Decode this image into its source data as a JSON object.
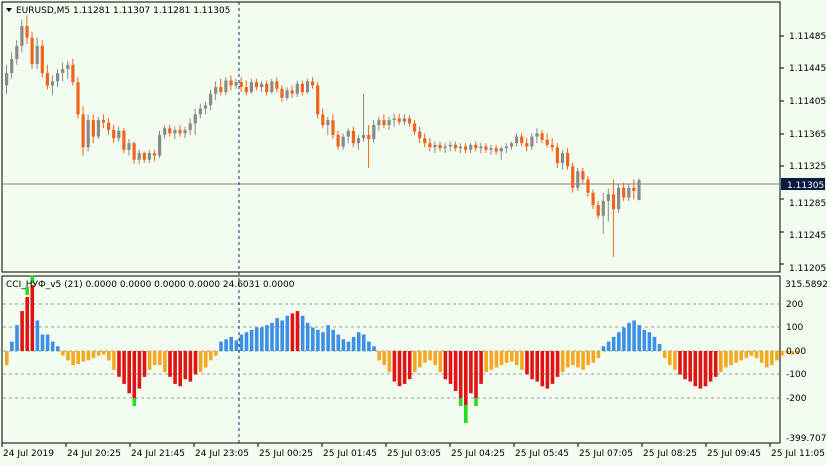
{
  "window": {
    "symbol_header": "EURUSD,M5  1.11281 1.11307 1.11281 1.11305",
    "indicator_header": "CCI_НУФ_v5 (21) 0.0000 0.0000 0.0000 0.0000 24.6031 0.0000",
    "current_price_label": "1.11305"
  },
  "colors": {
    "background": "#f2fdf0",
    "bull": "#8a8a8a",
    "bear": "#f0641e",
    "cci_blue": "#3c90e6",
    "cci_orange": "#f7a823",
    "cci_red": "#e01414",
    "cci_green": "#22dd22",
    "crosshair": "#1a2a6c",
    "current_price_bg": "#0c1a40"
  },
  "price_axis": {
    "ticks": [
      "1.11485",
      "1.11445",
      "1.11405",
      "1.11365",
      "1.11325",
      "1.11285",
      "1.11245",
      "1.11205"
    ],
    "current": "1.11305"
  },
  "indicator_axis": {
    "max_label": "315.5892",
    "min_label": "-399.7078",
    "ticks": [
      "200",
      "100",
      "0.00",
      "-100",
      "-200"
    ]
  },
  "time_axis": [
    "24 Jul 2019",
    "24 Jul 20:25",
    "24 Jul 21:45",
    "24 Jul 23:05",
    "25 Jul 00:25",
    "25 Jul 01:45",
    "25 Jul 03:05",
    "25 Jul 04:25",
    "25 Jul 05:45",
    "25 Jul 07:05",
    "25 Jul 08:25",
    "25 Jul 09:45",
    "25 Jul 11:05"
  ],
  "chart_data": [
    {
      "type": "candlestick",
      "title": "EURUSD,M5",
      "series": [
        {
          "name": "EURUSD,M5",
          "ohlc": [
            [
              1.1142,
              1.11445,
              1.1141,
              1.11435
            ],
            [
              1.11435,
              1.1146,
              1.11428,
              1.11452
            ],
            [
              1.11452,
              1.11475,
              1.11445,
              1.11468
            ],
            [
              1.11468,
              1.115,
              1.1146,
              1.11492
            ],
            [
              1.11492,
              1.11505,
              1.1147,
              1.11478
            ],
            [
              1.11478,
              1.11485,
              1.1144,
              1.11446
            ],
            [
              1.11446,
              1.11478,
              1.1144,
              1.11468
            ],
            [
              1.11468,
              1.11475,
              1.1143,
              1.11435
            ],
            [
              1.11435,
              1.11445,
              1.11415,
              1.1142
            ],
            [
              1.1142,
              1.11432,
              1.11408,
              1.11425
            ],
            [
              1.11425,
              1.1144,
              1.11418,
              1.11435
            ],
            [
              1.11435,
              1.11448,
              1.11425,
              1.1144
            ],
            [
              1.1144,
              1.1145,
              1.11428,
              1.11445
            ],
            [
              1.11445,
              1.11452,
              1.1142,
              1.11424
            ],
            [
              1.11424,
              1.1143,
              1.1138,
              1.11385
            ],
            [
              1.11385,
              1.11395,
              1.11335,
              1.11345
            ],
            [
              1.11345,
              1.11385,
              1.1134,
              1.11378
            ],
            [
              1.11378,
              1.11385,
              1.1135,
              1.11358
            ],
            [
              1.11358,
              1.11382,
              1.11355,
              1.11378
            ],
            [
              1.11378,
              1.11385,
              1.11368,
              1.11375
            ],
            [
              1.11375,
              1.1138,
              1.1136,
              1.11366
            ],
            [
              1.11366,
              1.11372,
              1.1135,
              1.11356
            ],
            [
              1.11356,
              1.1137,
              1.11352,
              1.11365
            ],
            [
              1.11365,
              1.11368,
              1.11338,
              1.11342
            ],
            [
              1.11342,
              1.11355,
              1.11335,
              1.1135
            ],
            [
              1.1135,
              1.11352,
              1.11325,
              1.1133
            ],
            [
              1.1133,
              1.11342,
              1.11325,
              1.11338
            ],
            [
              1.11338,
              1.1134,
              1.11326,
              1.1133
            ],
            [
              1.1133,
              1.11342,
              1.11326,
              1.11338
            ],
            [
              1.11338,
              1.11342,
              1.11328,
              1.11335
            ],
            [
              1.11335,
              1.11365,
              1.11332,
              1.1136
            ],
            [
              1.1136,
              1.11372,
              1.11355,
              1.11368
            ],
            [
              1.11368,
              1.11372,
              1.11358,
              1.11362
            ],
            [
              1.11362,
              1.1137,
              1.11355,
              1.11366
            ],
            [
              1.11366,
              1.11372,
              1.11358,
              1.11362
            ],
            [
              1.11362,
              1.1137,
              1.11356,
              1.11366
            ],
            [
              1.11366,
              1.1138,
              1.1136,
              1.11374
            ],
            [
              1.11374,
              1.11392,
              1.1136,
              1.11385
            ],
            [
              1.11385,
              1.11398,
              1.1138,
              1.11392
            ],
            [
              1.11392,
              1.114,
              1.11385,
              1.11396
            ],
            [
              1.11396,
              1.11415,
              1.1139,
              1.1141
            ],
            [
              1.1141,
              1.11425,
              1.11402,
              1.11418
            ],
            [
              1.11418,
              1.11428,
              1.11408,
              1.11412
            ],
            [
              1.11412,
              1.1143,
              1.11408,
              1.11426
            ],
            [
              1.11426,
              1.11432,
              1.11414,
              1.1142
            ],
            [
              1.1142,
              1.11428,
              1.11416,
              1.11424
            ],
            [
              1.11424,
              1.1143,
              1.11412,
              1.11418
            ],
            [
              1.11418,
              1.11426,
              1.11408,
              1.11412
            ],
            [
              1.11412,
              1.11428,
              1.1141,
              1.11424
            ],
            [
              1.11424,
              1.11428,
              1.11414,
              1.11418
            ],
            [
              1.11418,
              1.11425,
              1.11412,
              1.11422
            ],
            [
              1.11422,
              1.11426,
              1.11408,
              1.11412
            ],
            [
              1.11412,
              1.11428,
              1.1141,
              1.11425
            ],
            [
              1.11425,
              1.1143,
              1.11412,
              1.11416
            ],
            [
              1.11416,
              1.1142,
              1.114,
              1.11405
            ],
            [
              1.11405,
              1.11418,
              1.11402,
              1.11414
            ],
            [
              1.11414,
              1.1142,
              1.11405,
              1.1141
            ],
            [
              1.1141,
              1.11426,
              1.11406,
              1.11422
            ],
            [
              1.11422,
              1.11426,
              1.11408,
              1.11412
            ],
            [
              1.11412,
              1.11428,
              1.1141,
              1.11425
            ],
            [
              1.11425,
              1.1143,
              1.11416,
              1.1142
            ],
            [
              1.1142,
              1.11424,
              1.1138,
              1.11385
            ],
            [
              1.11385,
              1.11392,
              1.11368,
              1.11372
            ],
            [
              1.11372,
              1.11382,
              1.1136,
              1.11378
            ],
            [
              1.11378,
              1.11385,
              1.11355,
              1.1136
            ],
            [
              1.1136,
              1.11365,
              1.11342,
              1.11346
            ],
            [
              1.11346,
              1.11362,
              1.11342,
              1.11358
            ],
            [
              1.11358,
              1.11368,
              1.1135,
              1.11365
            ],
            [
              1.11365,
              1.1137,
              1.11345,
              1.1135
            ],
            [
              1.1135,
              1.1136,
              1.11342,
              1.11356
            ],
            [
              1.11356,
              1.1141,
              1.11352,
              1.1136
            ],
            [
              1.1136,
              1.11372,
              1.1132,
              1.11355
            ],
            [
              1.11355,
              1.11378,
              1.1135,
              1.11372
            ],
            [
              1.11372,
              1.11382,
              1.11365,
              1.11378
            ],
            [
              1.11378,
              1.11385,
              1.11368,
              1.11372
            ],
            [
              1.11372,
              1.11382,
              1.11366,
              1.11378
            ],
            [
              1.11378,
              1.11386,
              1.1137,
              1.1138
            ],
            [
              1.1138,
              1.11386,
              1.11372,
              1.11376
            ],
            [
              1.11376,
              1.11385,
              1.11372,
              1.1138
            ],
            [
              1.1138,
              1.11384,
              1.1137,
              1.11374
            ],
            [
              1.11374,
              1.11378,
              1.1136,
              1.11364
            ],
            [
              1.11364,
              1.1137,
              1.1135,
              1.11356
            ],
            [
              1.11356,
              1.11362,
              1.11345,
              1.1135
            ],
            [
              1.1135,
              1.11356,
              1.1134,
              1.11345
            ],
            [
              1.11345,
              1.11352,
              1.11338,
              1.11348
            ],
            [
              1.11348,
              1.11352,
              1.1134,
              1.11344
            ],
            [
              1.11344,
              1.1135,
              1.11338,
              1.11346
            ],
            [
              1.11346,
              1.11352,
              1.1134,
              1.11348
            ],
            [
              1.11348,
              1.11352,
              1.1134,
              1.11344
            ],
            [
              1.11344,
              1.1135,
              1.11338,
              1.11346
            ],
            [
              1.11346,
              1.1135,
              1.11338,
              1.11342
            ],
            [
              1.11342,
              1.1135,
              1.11338,
              1.11348
            ],
            [
              1.11348,
              1.11352,
              1.1134,
              1.11344
            ],
            [
              1.11344,
              1.1135,
              1.11338,
              1.11346
            ],
            [
              1.11346,
              1.1135,
              1.11338,
              1.11342
            ],
            [
              1.11342,
              1.11348,
              1.11336,
              1.11344
            ],
            [
              1.11344,
              1.11348,
              1.11336,
              1.1134
            ],
            [
              1.1134,
              1.11346,
              1.1133,
              1.11344
            ],
            [
              1.11344,
              1.1135,
              1.11338,
              1.11346
            ],
            [
              1.11346,
              1.11352,
              1.11342,
              1.1135
            ],
            [
              1.1135,
              1.11362,
              1.11346,
              1.11358
            ],
            [
              1.11358,
              1.11362,
              1.11346,
              1.1135
            ],
            [
              1.1135,
              1.11356,
              1.1134,
              1.11346
            ],
            [
              1.11346,
              1.11362,
              1.11342,
              1.11358
            ],
            [
              1.11358,
              1.11368,
              1.1135,
              1.11362
            ],
            [
              1.11362,
              1.11366,
              1.1135,
              1.11354
            ],
            [
              1.11354,
              1.11362,
              1.11345,
              1.11348
            ],
            [
              1.11348,
              1.11356,
              1.1134,
              1.11345
            ],
            [
              1.11345,
              1.1135,
              1.1132,
              1.11326
            ],
            [
              1.11326,
              1.11342,
              1.11318,
              1.11338
            ],
            [
              1.11338,
              1.11344,
              1.11318,
              1.11322
            ],
            [
              1.11322,
              1.11326,
              1.1129,
              1.11296
            ],
            [
              1.11296,
              1.1132,
              1.11292,
              1.11316
            ],
            [
              1.11316,
              1.1132,
              1.113,
              1.11306
            ],
            [
              1.11306,
              1.1131,
              1.11285,
              1.1129
            ],
            [
              1.1129,
              1.11294,
              1.1127,
              1.11275
            ],
            [
              1.11275,
              1.1128,
              1.11258,
              1.11262
            ],
            [
              1.11262,
              1.1129,
              1.1124,
              1.1128
            ],
            [
              1.1128,
              1.11295,
              1.11255,
              1.11288
            ],
            [
              1.11288,
              1.11306,
              1.11212,
              1.1127
            ],
            [
              1.1127,
              1.113,
              1.11266,
              1.11296
            ],
            [
              1.11296,
              1.11302,
              1.1128,
              1.11284
            ],
            [
              1.11284,
              1.113,
              1.1128,
              1.11296
            ],
            [
              1.11296,
              1.11306,
              1.11282,
              1.11292
            ],
            [
              1.11281,
              1.11307,
              1.11281,
              1.11305
            ]
          ]
        }
      ],
      "ylim": [
        1.11195,
        1.1152
      ]
    },
    {
      "type": "bar",
      "title": "CCI_НУФ_v5 (21)",
      "series": [
        {
          "name": "CCI_НУФ_v5 (21)",
          "values": [
            -60,
            40,
            110,
            170,
            230,
            280,
            130,
            70,
            70,
            40,
            20,
            -20,
            -40,
            -60,
            -55,
            -45,
            -40,
            -30,
            -20,
            -15,
            -40,
            -80,
            -110,
            -140,
            -180,
            -200,
            -160,
            -110,
            -80,
            -60,
            -60,
            -90,
            -110,
            -140,
            -150,
            -120,
            -130,
            -100,
            -90,
            -70,
            -40,
            -20,
            40,
            50,
            60,
            45,
            70,
            80,
            90,
            100,
            100,
            110,
            120,
            140,
            130,
            150,
            160,
            170,
            150,
            120,
            100,
            90,
            80,
            110,
            90,
            70,
            50,
            40,
            60,
            80,
            70,
            40,
            20,
            -40,
            -60,
            -90,
            -130,
            -150,
            -140,
            -120,
            -90,
            -70,
            -50,
            -40,
            -60,
            -90,
            -120,
            -140,
            -170,
            -200,
            -230,
            -180,
            -200,
            -140,
            -90,
            -80,
            -70,
            -60,
            -50,
            -45,
            -60,
            -80,
            -100,
            -120,
            -130,
            -150,
            -160,
            -140,
            -110,
            -90,
            -70,
            -60,
            -70,
            -80,
            -60,
            -50,
            -30,
            20,
            40,
            60,
            80,
            100,
            120,
            130,
            110,
            90,
            80,
            60,
            30,
            -30,
            -60,
            -80,
            -100,
            -120,
            -130,
            -150,
            -160,
            -150,
            -130,
            -110,
            -90,
            -70,
            -60,
            -50,
            -40,
            -30,
            -20,
            -30,
            -50,
            -70,
            -60,
            -40,
            -20,
            -10,
            -15,
            -10
          ]
        }
      ],
      "ylim": [
        -399.7078,
        315.5892
      ]
    }
  ]
}
